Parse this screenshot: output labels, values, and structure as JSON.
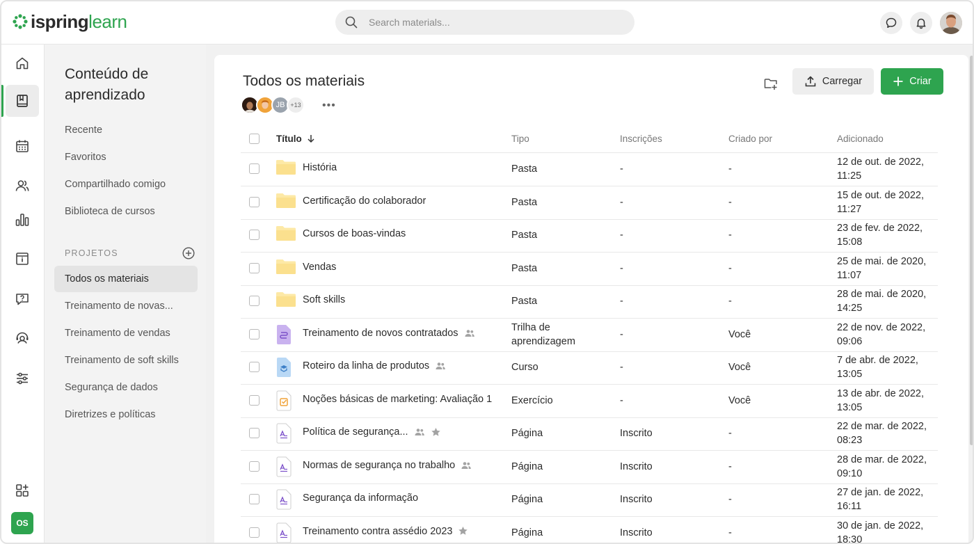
{
  "logo": {
    "part1": "ispring",
    "part2": "learn"
  },
  "search": {
    "placeholder": "Search materials..."
  },
  "sidebar": {
    "title": "Conteúdo de aprendizado",
    "links": [
      "Recente",
      "Favoritos",
      "Compartilhado comigo",
      "Biblioteca de cursos"
    ],
    "section_label": "PROJETOS",
    "projects": [
      "Todos os materiais",
      "Treinamento de novas...",
      "Treinamento de vendas",
      "Treinamento de soft skills",
      "Segurança de dados",
      "Diretrizes e políticas"
    ]
  },
  "rail": {
    "user_initials": "OS"
  },
  "main": {
    "title": "Todos os materiais",
    "avatar_initials": "JB",
    "avatar_more": "+13",
    "dots": "•••",
    "upload_label": "Carregar",
    "create_label": "Criar"
  },
  "table": {
    "headers": {
      "title": "Título",
      "type": "Tipo",
      "enrollments": "Inscrições",
      "created_by": "Criado por",
      "added": "Adicionado"
    },
    "rows": [
      {
        "icon": "folder-icon",
        "title": "História",
        "type": "Pasta",
        "enroll": "-",
        "by": "-",
        "added1": "12 de out. de 2022,",
        "added2": "11:25"
      },
      {
        "icon": "folder-icon",
        "title": "Certificação do colaborador",
        "type": "Pasta",
        "enroll": "-",
        "by": "-",
        "added1": "15 de out. de 2022,",
        "added2": "11:27"
      },
      {
        "icon": "folder-icon",
        "title": "Cursos de boas-vindas",
        "type": "Pasta",
        "enroll": "-",
        "by": "-",
        "added1": "23 de fev. de 2022,",
        "added2": "15:08"
      },
      {
        "icon": "folder-icon",
        "title": "Vendas",
        "type": "Pasta",
        "enroll": "-",
        "by": "-",
        "added1": "25 de mai. de 2020,",
        "added2": "11:07"
      },
      {
        "icon": "folder-icon",
        "title": "Soft skills",
        "type": "Pasta",
        "enroll": "-",
        "by": "-",
        "added1": "28 de mai. de 2020,",
        "added2": "14:25"
      },
      {
        "icon": "learning-path-icon",
        "title": "Treinamento de novos contratados",
        "type": "Trilha de",
        "type2": "aprendizagem",
        "enroll": "-",
        "by": "Você",
        "added1": "22 de nov. de 2022,",
        "added2": "09:06",
        "shared": true
      },
      {
        "icon": "course-icon",
        "title": "Roteiro da linha de produtos",
        "type": "Curso",
        "enroll": "-",
        "by": "Você",
        "added1": "7 de abr. de 2022,",
        "added2": "13:05",
        "shared": true
      },
      {
        "icon": "quiz-icon",
        "title": "Noções básicas de marketing: Avaliação 1",
        "type": "Exercício",
        "enroll": "-",
        "by": "Você",
        "added1": "13 de abr. de 2022,",
        "added2": "13:05"
      },
      {
        "icon": "page-icon",
        "title": "Política de segurança...",
        "type": "Página",
        "enroll": "Inscrito",
        "by": "-",
        "added1": "22 de mar. de 2022,",
        "added2": "08:23",
        "shared": true,
        "star": true
      },
      {
        "icon": "page-icon",
        "title": "Normas de segurança no trabalho",
        "type": "Página",
        "enroll": "Inscrito",
        "by": "-",
        "added1": "28 de mar. de 2022,",
        "added2": "09:10",
        "shared": true
      },
      {
        "icon": "page-icon",
        "title": "Segurança da informação",
        "type": "Página",
        "enroll": "Inscrito",
        "by": "-",
        "added1": "27 de jan. de 2022,",
        "added2": "16:11"
      },
      {
        "icon": "page-icon",
        "title": "Treinamento contra assédio 2023",
        "type": "Página",
        "enroll": "Inscrito",
        "by": "-",
        "added1": "30 de jan. de 2022,",
        "added2": "18:30",
        "star": true
      }
    ]
  },
  "colors": {
    "accent": "#2ea44f",
    "folder": "#fde9a6",
    "page_accent": "#7b4fc9"
  }
}
